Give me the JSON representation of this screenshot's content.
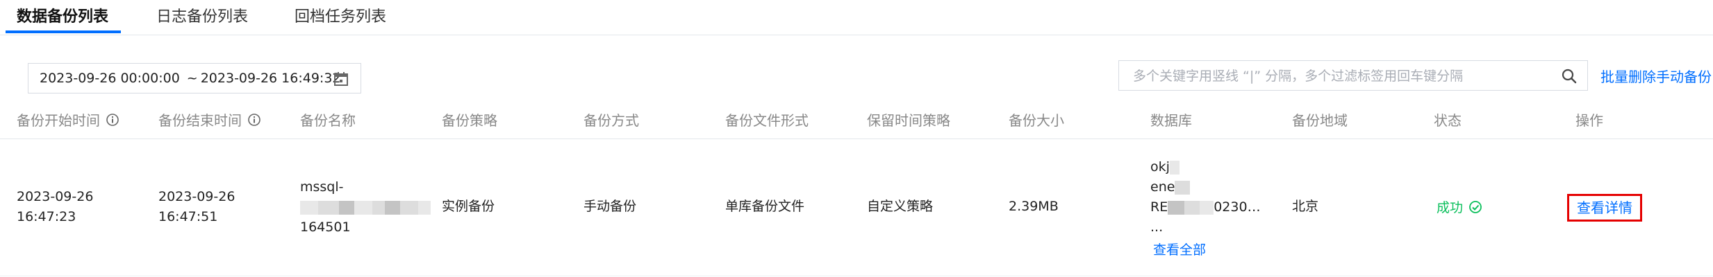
{
  "tabs": [
    {
      "label": "数据备份列表",
      "active": true
    },
    {
      "label": "日志备份列表",
      "active": false
    },
    {
      "label": "回档任务列表",
      "active": false
    }
  ],
  "toolbar": {
    "date_start": "2023-09-26 00:00:00",
    "date_separator": "~",
    "date_end": "2023-09-26 16:49:32",
    "search_placeholder": "多个关键字用竖线 “|” 分隔，多个过滤标签用回车键分隔",
    "batch_delete_label": "批量删除手动备份"
  },
  "table": {
    "columns": [
      "备份开始时间",
      "备份结束时间",
      "备份名称",
      "备份策略",
      "备份方式",
      "备份文件形式",
      "保留时间策略",
      "备份大小",
      "数据库",
      "备份地域",
      "状态",
      "操作"
    ],
    "rows": [
      {
        "start_date": "2023-09-26",
        "start_time": "16:47:23",
        "end_date": "2023-09-26",
        "end_time": "16:47:51",
        "name_prefix": "mssql-",
        "name_suffix": "164501",
        "policy": "实例备份",
        "method": "手动备份",
        "file_form": "单库备份文件",
        "retention": "自定义策略",
        "size": "2.39MB",
        "db_line1": "okj",
        "db_line2": "ene",
        "db_line3_prefix": "RE",
        "db_line3_suffix": "0230…",
        "db_more": "...",
        "db_view_all": "查看全部",
        "region": "北京",
        "status": "成功",
        "action": "查看详情"
      }
    ]
  },
  "colors": {
    "accent": "#006eff",
    "success": "#0abf5b",
    "highlight_border": "#e50000"
  }
}
